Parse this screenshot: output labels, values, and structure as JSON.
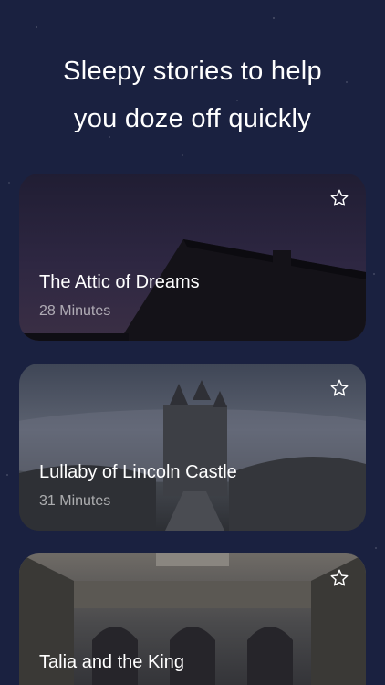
{
  "headline": {
    "line1": "Sleepy stories to help",
    "line2": "you doze off quickly"
  },
  "stories": [
    {
      "title": "The Attic of Dreams",
      "duration": "28 Minutes",
      "favorite_icon": "star-outline-icon"
    },
    {
      "title": "Lullaby of Lincoln Castle",
      "duration": "31 Minutes",
      "favorite_icon": "star-outline-icon"
    },
    {
      "title": "Talia and the King",
      "duration": "",
      "favorite_icon": "star-outline-icon"
    }
  ],
  "colors": {
    "background": "#1a2140",
    "text": "#ffffff"
  }
}
